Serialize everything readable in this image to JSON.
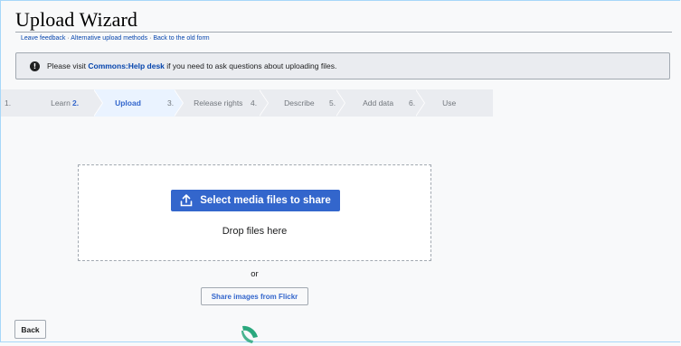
{
  "page": {
    "title": "Upload Wizard",
    "links": [
      "Leave feedback",
      "Alternative upload methods",
      "Back to the old form"
    ],
    "link_separator": " · "
  },
  "notice": {
    "icon": "info-icon",
    "prefix": "Please visit ",
    "link": "Commons:Help desk",
    "suffix": " if you need to ask questions about uploading files."
  },
  "steps": [
    {
      "num": "1.",
      "label": "Learn"
    },
    {
      "num": "2.",
      "label": "Upload"
    },
    {
      "num": "3.",
      "label": "Release rights"
    },
    {
      "num": "4.",
      "label": "Describe"
    },
    {
      "num": "5.",
      "label": "Add data"
    },
    {
      "num": "6.",
      "label": "Use"
    }
  ],
  "active_step": 1,
  "dropzone": {
    "select_label": "Select media files to share",
    "drop_text": "Drop files here"
  },
  "or_text": "or",
  "flickr_label": "Share images from Flickr",
  "back_label": "Back",
  "colors": {
    "accent": "#3366cc",
    "link": "#0645ad",
    "spinner": "#2aa87d"
  }
}
